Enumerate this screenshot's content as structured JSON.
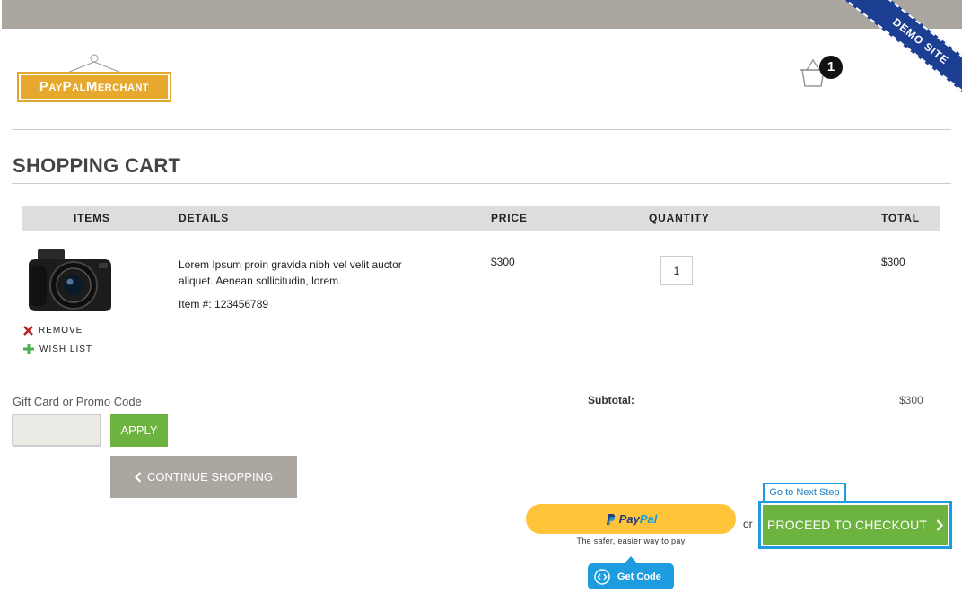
{
  "header": {
    "logo_text": "PayPalMerchant",
    "ribbon_text": "DEMO SITE",
    "cart_count": "1"
  },
  "page": {
    "title": "SHOPPING CART"
  },
  "table": {
    "columns": [
      "ITEMS",
      "DETAILS",
      "PRICE",
      "QUANTITY",
      "TOTAL"
    ],
    "rows": [
      {
        "description": "Lorem Ipsum proin gravida nibh vel velit auctor aliquet. Aenean sollicitudin, lorem.",
        "item_number": "Item #: 123456789",
        "price": "$300",
        "quantity": "1",
        "total": "$300",
        "remove_label": "REMOVE",
        "wishlist_label": "WISH LIST"
      }
    ]
  },
  "promo": {
    "label": "Gift Card or Promo Code",
    "input_value": "",
    "apply_label": "APPLY"
  },
  "continue": {
    "label": "CONTINUE SHOPPING"
  },
  "summary": {
    "subtotal_label": "Subtotal:",
    "subtotal_value": "$300"
  },
  "paypal": {
    "pay": "Pay",
    "pal": "Pal",
    "tagline": "The safer, easier way to pay",
    "get_code_label": "Get Code",
    "or_text": "or"
  },
  "checkout": {
    "next_step_label": "Go to Next Step",
    "label": "PROCEED TO CHECKOUT"
  },
  "colors": {
    "topbar": "#aba7a0",
    "ribbon": "#1c3f93",
    "green": "#6db33f",
    "highlight_blue": "#1e9ce0",
    "paypal_yellow": "#ffc439",
    "logo_gold": "#e7a82e"
  }
}
